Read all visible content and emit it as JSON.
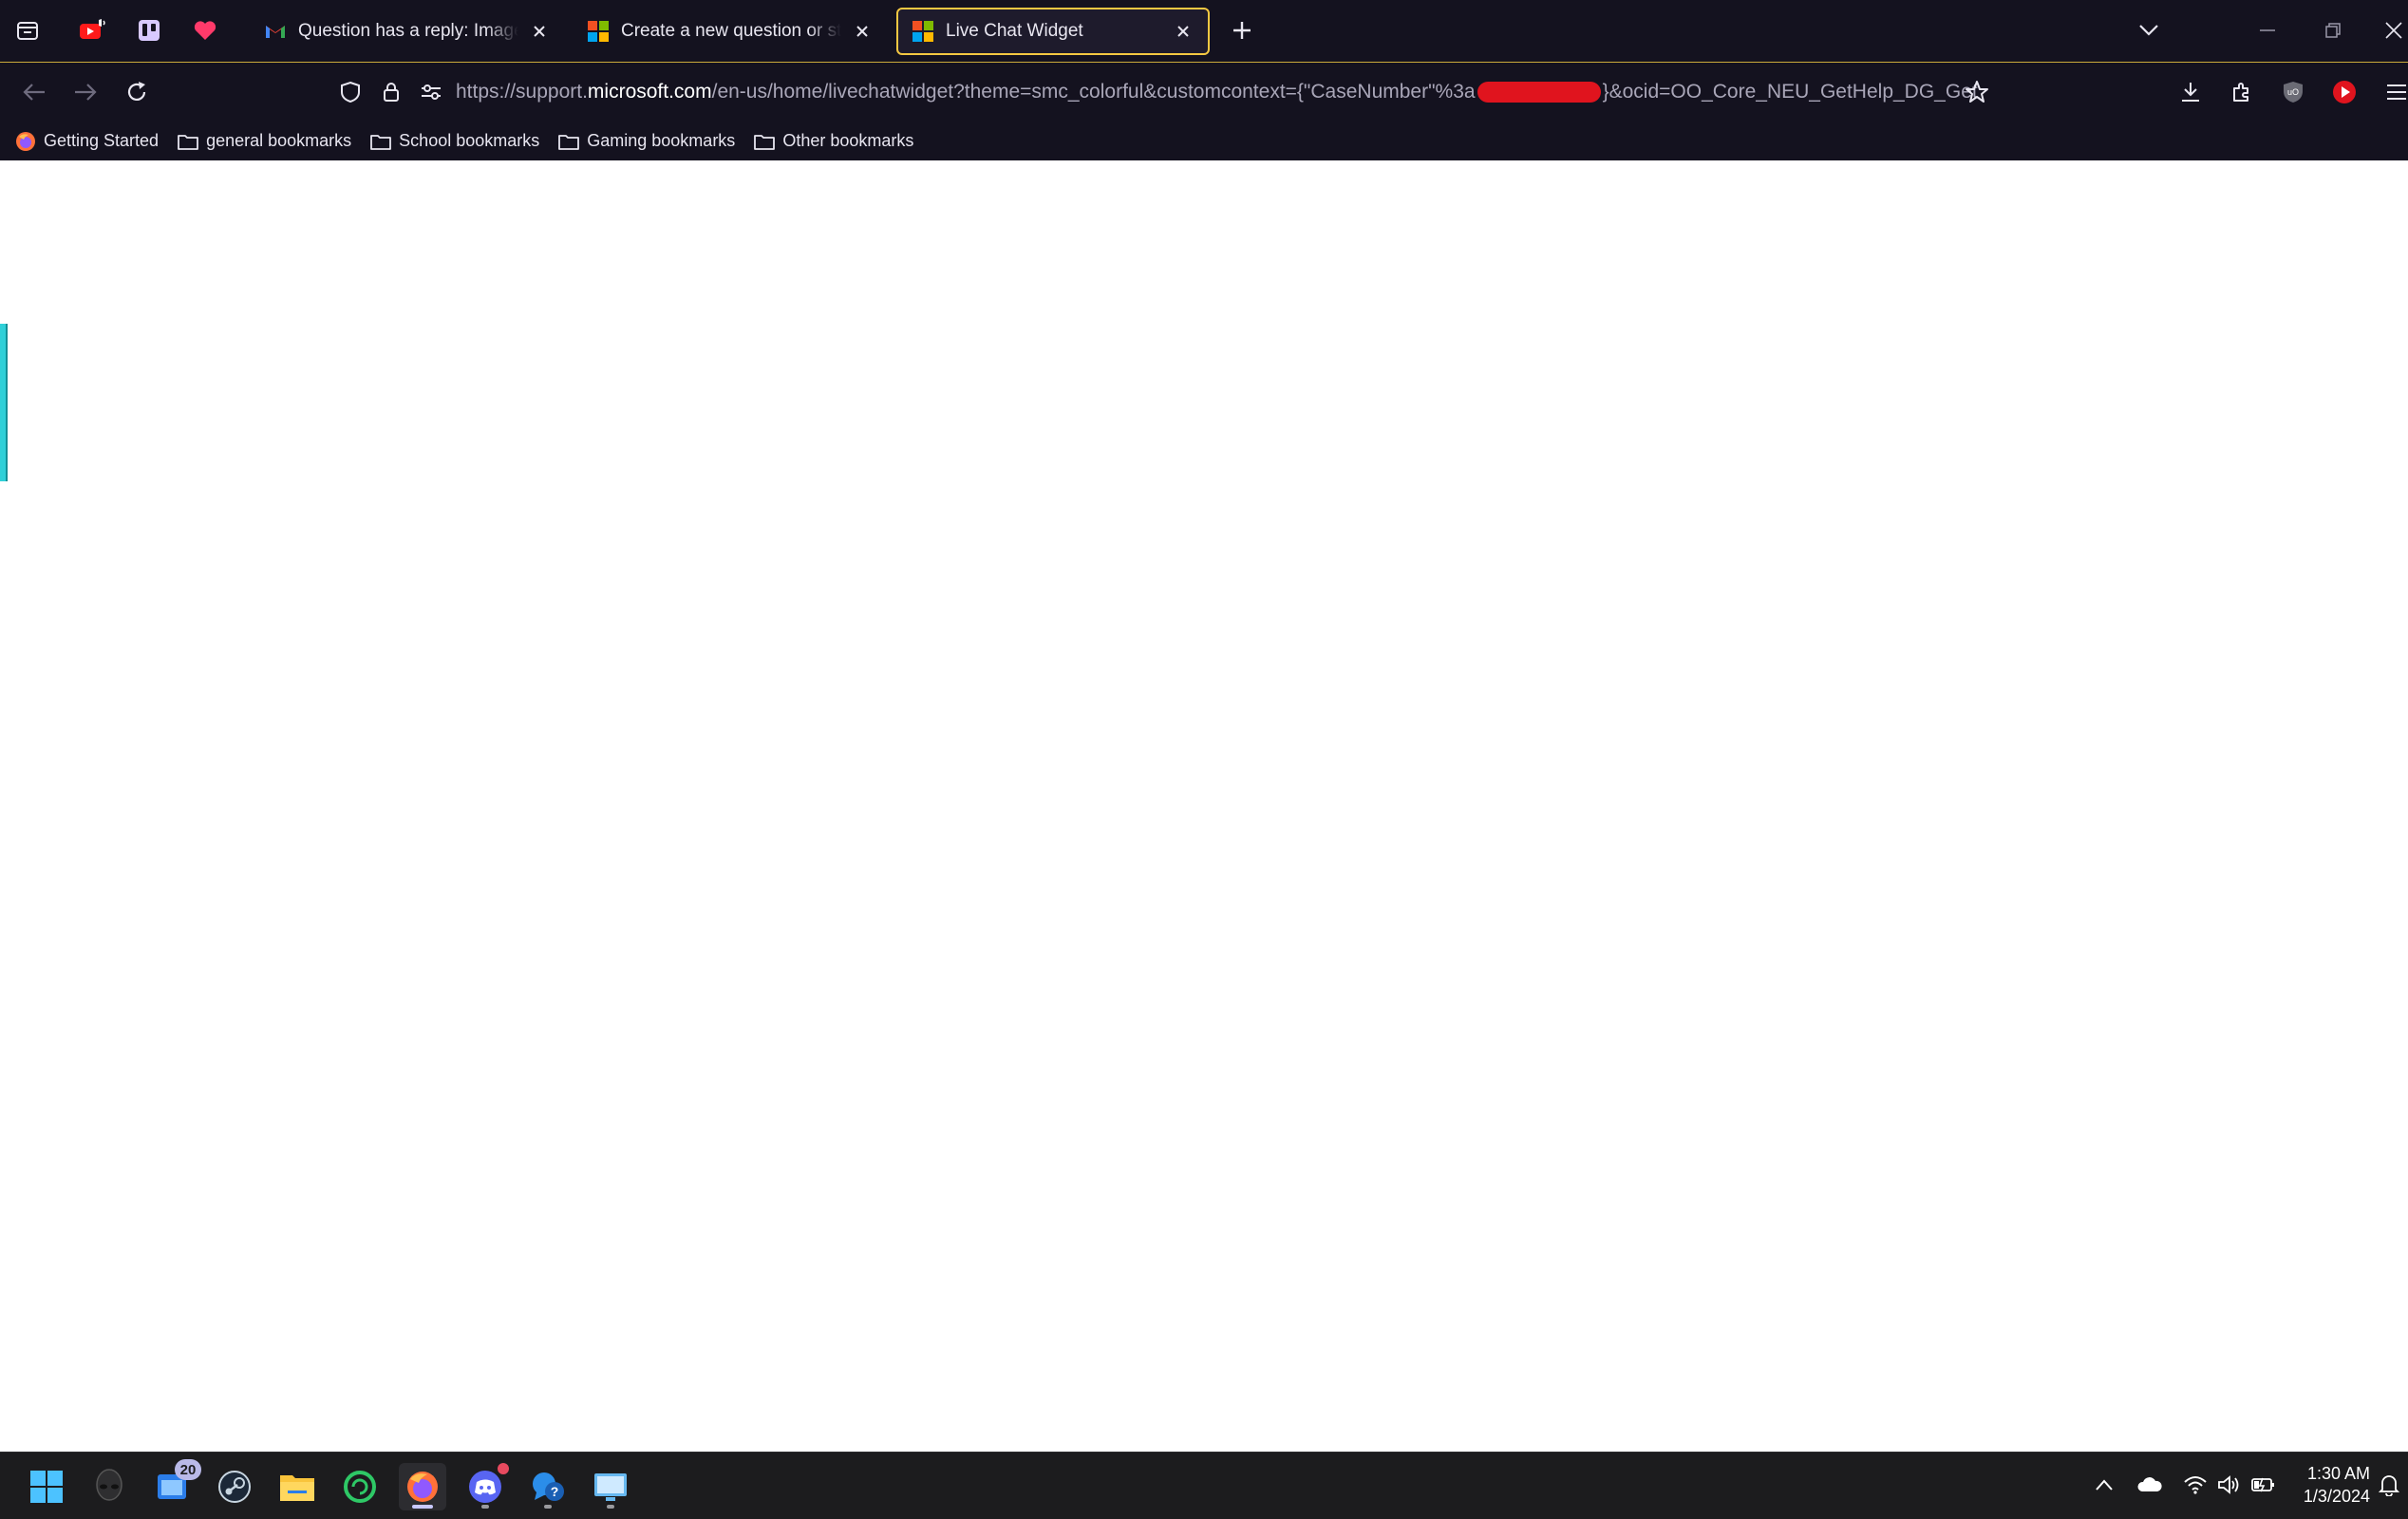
{
  "browser": {
    "tabs": [
      {
        "label": "Question has a reply: Image upl",
        "favicon": "gmail-icon",
        "active": false
      },
      {
        "label": "Create a new question or start a",
        "favicon": "microsoft-icon",
        "active": false
      },
      {
        "label": "Live Chat Widget",
        "favicon": "microsoft-icon",
        "active": true
      }
    ],
    "pinned_tabs": [
      "youtube-icon",
      "trello-icon",
      "heart-icon"
    ],
    "url": {
      "prefix": "https://support.",
      "host": "microsoft.com",
      "path": "/en-us/home/livechatwidget?theme=smc_colorful&customcontext={\"CaseNumber\"%3a",
      "suffix": "}&ocid=OO_Core_NEU_GetHelp_DG_Get"
    },
    "bookmarks": [
      {
        "label": "Getting Started",
        "icon": "firefox-icon"
      },
      {
        "label": "general bookmarks",
        "icon": "folder-icon"
      },
      {
        "label": "School bookmarks",
        "icon": "folder-icon"
      },
      {
        "label": "Gaming bookmarks",
        "icon": "folder-icon"
      },
      {
        "label": "Other bookmarks",
        "icon": "folder-icon"
      }
    ]
  },
  "taskbar": {
    "badge_count": "20",
    "clock": {
      "time": "1:30 AM",
      "date": "1/3/2024"
    }
  },
  "colors": {
    "chrome_bg": "#14121f",
    "active_tab_border": "#f4c842",
    "side_bar": "#2fd0d8",
    "taskbar_bg": "#1c1c1e"
  }
}
